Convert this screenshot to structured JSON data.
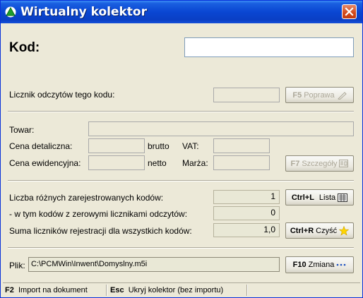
{
  "window": {
    "title": "Wirtualny kolektor"
  },
  "kod": {
    "label": "Kod:",
    "value": ""
  },
  "counter": {
    "label": "Licznik odczytów tego kodu:",
    "value": "",
    "fix_key": "F5",
    "fix_label": "Poprawa"
  },
  "product": {
    "towar_label": "Towar:",
    "towar_value": "",
    "retail_price_label": "Cena detaliczna:",
    "retail_price_value": "",
    "brutto_label": "brutto",
    "vat_label": "VAT:",
    "vat_value": "",
    "record_price_label": "Cena ewidencyjna:",
    "record_price_value": "",
    "netto_label": "netto",
    "margin_label": "Marża:",
    "margin_value": "",
    "details_key": "F7",
    "details_label": "Szczegóły"
  },
  "stats": {
    "distinct_codes_label": "Liczba różnych zarejestrowanych kodów:",
    "distinct_codes_value": "1",
    "zero_counter_label": "- w tym kodów z zerowymi licznikami odczytów:",
    "zero_counter_value": "0",
    "sum_label": "Suma liczników rejestracji dla wszystkich kodów:",
    "sum_value": "1,0",
    "list_key": "Ctrl+L",
    "list_label": "Lista",
    "clear_key": "Ctrl+R",
    "clear_label": "Czyść"
  },
  "file": {
    "label": "Plik:",
    "path": "C:\\PCMWin\\Inwent\\Domyslny.m5i",
    "change_key": "F10",
    "change_label": "Zmiana"
  },
  "statusbar": {
    "import_key": "F2",
    "import_label": "Import na dokument",
    "hide_key": "Esc",
    "hide_label": "Ukryj kolektor (bez importu)"
  },
  "icons": {
    "app": "green-triangle-icon",
    "close": "close-icon",
    "list": "list-icon",
    "clear": "star-icon",
    "change": "ellipsis-icon",
    "fix": "pen-icon",
    "details": "card-icon"
  },
  "colors": {
    "title_bar": "#0a46d2",
    "close_button": "#d2491a",
    "face": "#ece9d8",
    "readonly_field": "#e9e8d6"
  }
}
